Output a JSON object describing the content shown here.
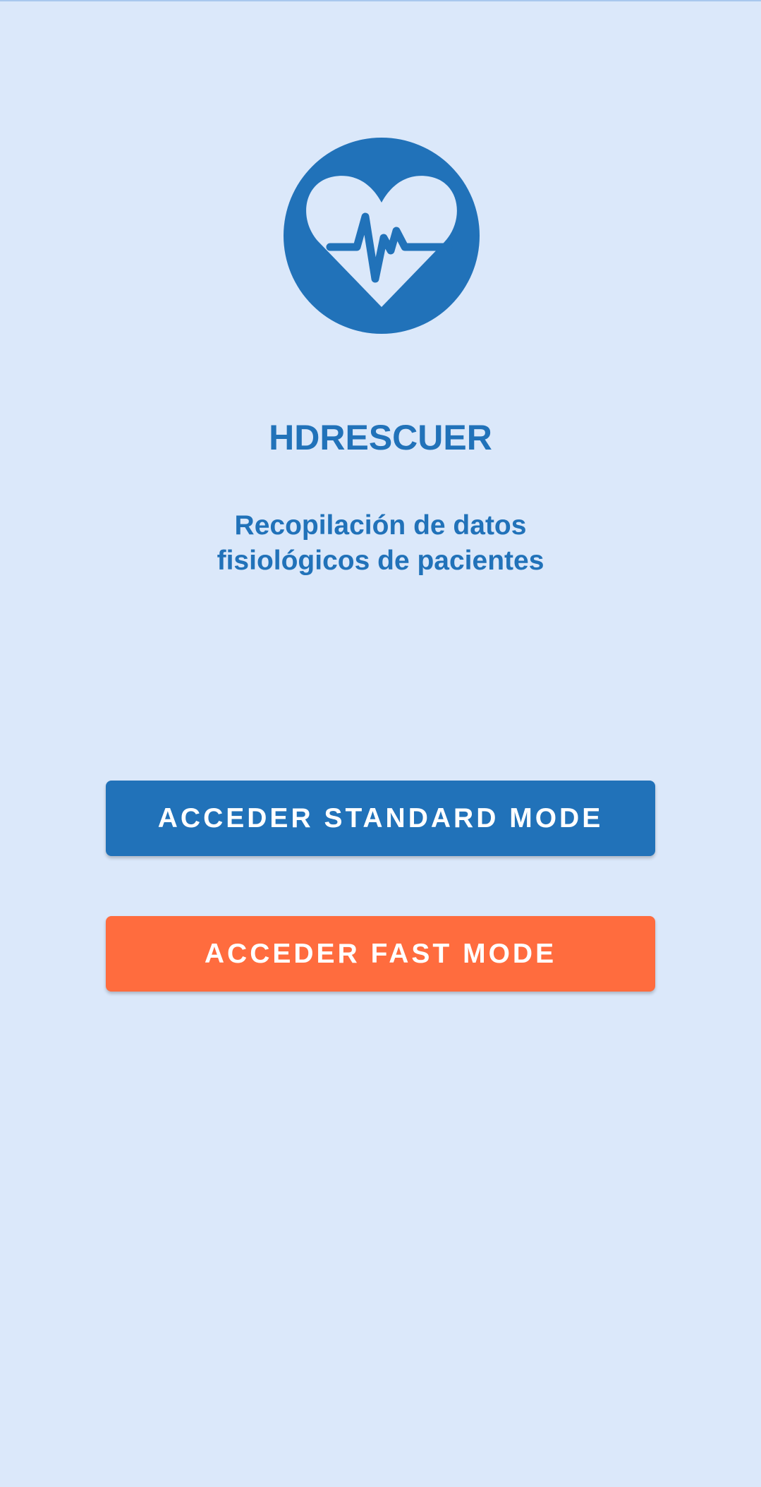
{
  "app": {
    "title": "HDRESCUER",
    "subtitle_line1": "Recopilación de datos",
    "subtitle_line2": "fisiológicos de pacientes",
    "logo_icon": "heart-pulse-icon"
  },
  "buttons": {
    "standard_label": "ACCEDER STANDARD MODE",
    "fast_label": "ACCEDER FAST MODE"
  },
  "colors": {
    "background": "#dbe8fa",
    "primary": "#2172b9",
    "accent": "#ff6c3e"
  }
}
